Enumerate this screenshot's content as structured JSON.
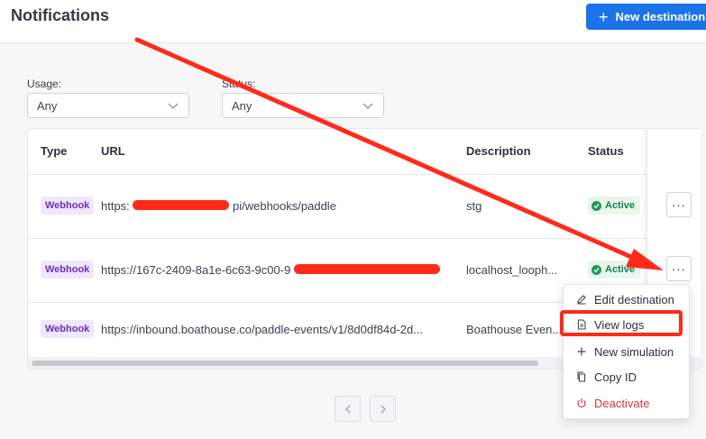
{
  "header": {
    "title": "Notifications",
    "new_button_label": "New destination"
  },
  "filters": {
    "usage": {
      "label": "Usage:",
      "value": "Any"
    },
    "status": {
      "label": "Status:",
      "value": "Any"
    }
  },
  "table": {
    "columns": [
      "Type",
      "URL",
      "Description",
      "Status"
    ],
    "rows": [
      {
        "type": "Webhook",
        "url_prefix": "https:",
        "url_suffix": "pi/webhooks/paddle",
        "description": "stg",
        "status": "Active"
      },
      {
        "type": "Webhook",
        "url": "https://167c-2409-8a1e-6c63-9c00-9",
        "description": "localhost_looph...",
        "status": "Active"
      },
      {
        "type": "Webhook",
        "url": "https://inbound.boathouse.co/paddle-events/v1/8d0df84d-2d...",
        "description": "Boathouse Even..."
      }
    ],
    "more_label": "···"
  },
  "context_menu": {
    "items": [
      {
        "label": "Edit destination",
        "icon": "pencil-icon"
      },
      {
        "label": "View logs",
        "icon": "document-icon"
      },
      {
        "label": "New simulation",
        "icon": "plus-icon"
      },
      {
        "label": "Copy ID",
        "icon": "copy-icon"
      },
      {
        "label": "Deactivate",
        "icon": "power-icon"
      }
    ]
  },
  "colors": {
    "primary": "#1a73e8",
    "annotation_red": "#ff2a1a",
    "active_green": "#1e7d46",
    "webhook_purple": "#6b2fb3",
    "danger": "#d5343d"
  }
}
